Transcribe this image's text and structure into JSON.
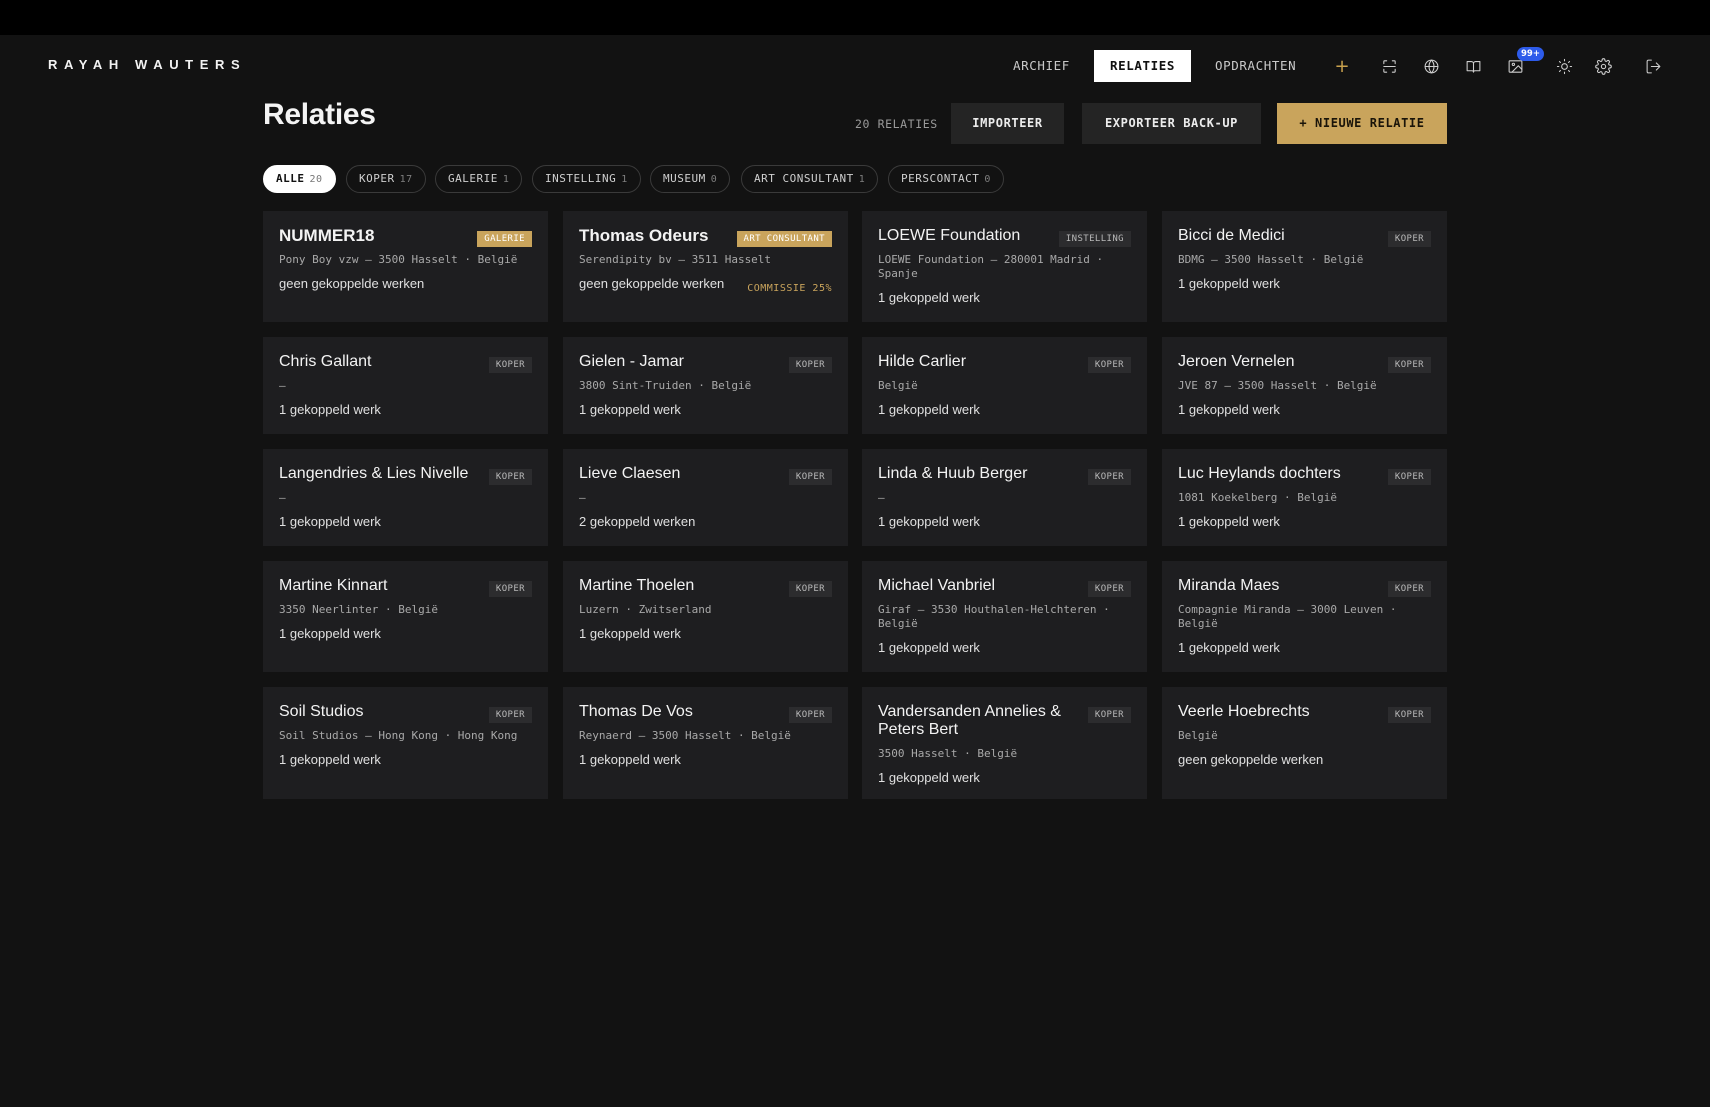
{
  "brand": "RAYAH WAUTERS",
  "nav": {
    "archief": "ARCHIEF",
    "relaties": "RELATIES",
    "opdrachten": "OPDRACHTEN"
  },
  "notifications_badge": "99+",
  "page": {
    "title": "Relaties",
    "count_label": "20 RELATIES",
    "import_label": "IMPORTEER",
    "export_label": "EXPORTEER BACK-UP",
    "new_label": "+ NIEUWE RELATIE"
  },
  "filters": [
    {
      "label": "ALLE",
      "count": "20",
      "active": true
    },
    {
      "label": "KOPER",
      "count": "17"
    },
    {
      "label": "GALERIE",
      "count": "1"
    },
    {
      "label": "INSTELLING",
      "count": "1"
    },
    {
      "label": "MUSEUM",
      "count": "0"
    },
    {
      "label": "ART CONSULTANT",
      "count": "1"
    },
    {
      "label": "PERSCONTACT",
      "count": "0"
    }
  ],
  "cards": [
    {
      "name": "NUMMER18",
      "tag": "GALERIE",
      "address": "Pony Boy vzw — 3500 Hasselt · België",
      "works": "geen gekoppelde werken"
    },
    {
      "name": "Thomas Odeurs",
      "tag": "ART CONSULTANT",
      "address": "Serendipity bv — 3511 Hasselt",
      "works": "geen gekoppelde werken",
      "commission": "COMMISSIE 25%"
    },
    {
      "name": "LOEWE Foundation",
      "tag": "INSTELLING",
      "address": "LOEWE Foundation — 280001 Madrid · Spanje",
      "works": "1 gekoppeld werk"
    },
    {
      "name": "Bicci de Medici",
      "tag": "KOPER",
      "address": "BDMG — 3500 Hasselt · België",
      "works": "1 gekoppeld werk"
    },
    {
      "name": "Chris Gallant",
      "tag": "KOPER",
      "address": "—",
      "works": "1 gekoppeld werk"
    },
    {
      "name": "Gielen - Jamar",
      "tag": "KOPER",
      "address": "3800 Sint-Truiden · België",
      "works": "1 gekoppeld werk"
    },
    {
      "name": "Hilde Carlier",
      "tag": "KOPER",
      "address": "België",
      "works": "1 gekoppeld werk"
    },
    {
      "name": "Jeroen Vernelen",
      "tag": "KOPER",
      "address": "JVE 87 — 3500 Hasselt · België",
      "works": "1 gekoppeld werk"
    },
    {
      "name": "Langendries & Lies Nivelle",
      "tag": "KOPER",
      "address": "—",
      "works": "1 gekoppeld werk"
    },
    {
      "name": "Lieve Claesen",
      "tag": "KOPER",
      "address": "—",
      "works": "2 gekoppeld werken"
    },
    {
      "name": "Linda & Huub Berger",
      "tag": "KOPER",
      "address": "—",
      "works": "1 gekoppeld werk"
    },
    {
      "name": "Luc Heylands dochters",
      "tag": "KOPER",
      "address": "1081 Koekelberg · België",
      "works": "1 gekoppeld werk"
    },
    {
      "name": "Martine Kinnart",
      "tag": "KOPER",
      "address": "3350 Neerlinter · België",
      "works": "1 gekoppeld werk"
    },
    {
      "name": "Martine Thoelen",
      "tag": "KOPER",
      "address": "Luzern · Zwitserland",
      "works": "1 gekoppeld werk"
    },
    {
      "name": "Michael Vanbriel",
      "tag": "KOPER",
      "address": "Giraf — 3530 Houthalen-Helchteren · België",
      "works": "1 gekoppeld werk"
    },
    {
      "name": "Miranda Maes",
      "tag": "KOPER",
      "address": "Compagnie Miranda — 3000 Leuven · België",
      "works": "1 gekoppeld werk"
    },
    {
      "name": "Soil Studios",
      "tag": "KOPER",
      "address": "Soil Studios — Hong Kong · Hong Kong",
      "works": "1 gekoppeld werk"
    },
    {
      "name": "Thomas De Vos",
      "tag": "KOPER",
      "address": "Reynaerd — 3500 Hasselt · België",
      "works": "1 gekoppeld werk"
    },
    {
      "name": "Vandersanden Annelies & Peters Bert",
      "tag": "KOPER",
      "address": "3500 Hasselt · België",
      "works": "1 gekoppeld werk"
    },
    {
      "name": "Veerle Hoebrechts",
      "tag": "KOPER",
      "address": "België",
      "works": "geen gekoppelde werken"
    }
  ]
}
